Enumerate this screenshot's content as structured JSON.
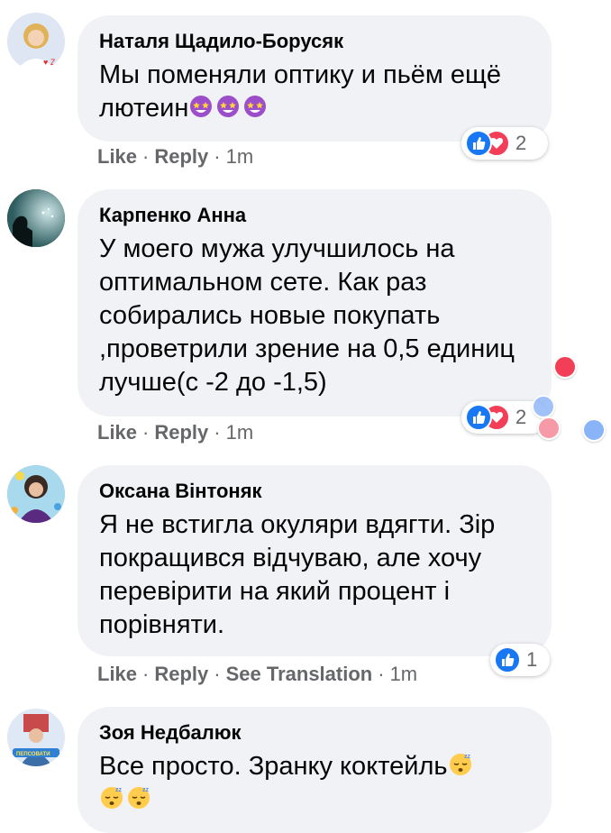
{
  "comments": [
    {
      "author": "Наталя Щадило-Борусяк",
      "text": "Мы поменяли оптику и пьём ещё лютеин",
      "emojis": [
        "star-struck-icon",
        "star-struck-icon",
        "star-struck-icon"
      ],
      "actions": {
        "like": "Like",
        "reply": "Reply",
        "time": "1m"
      },
      "reactions": {
        "types": [
          "like",
          "love"
        ],
        "count": "2"
      }
    },
    {
      "author": "Карпенко Анна",
      "text": "У моего мужа улучшилось на оптимальном сете. Как раз собирались новые покупать ,проветрили зрение на 0,5 единиц лучше(с -2 до -1,5)",
      "actions": {
        "like": "Like",
        "reply": "Reply",
        "time": "1m"
      },
      "reactions": {
        "types": [
          "like",
          "love"
        ],
        "count": "2"
      }
    },
    {
      "author": "Оксана Вінтоняк",
      "text": "Я не встигла окуляри вдягти. Зір покращився відчуваю, але хочу перевірити на який процент і порівняти.",
      "actions": {
        "like": "Like",
        "reply": "Reply",
        "translate": "See Translation",
        "time": "1m"
      },
      "reactions": {
        "types": [
          "like"
        ],
        "count": "1"
      }
    },
    {
      "author": "Зоя Недбалюк",
      "text": "Все просто. Зранку коктейль",
      "emojis": [
        "sleeping-face-icon",
        "sleeping-face-icon",
        "sleeping-face-icon"
      ]
    }
  ],
  "colors": {
    "bubble": "#f0f2f5",
    "meta": "#65676b",
    "like": "#1877f2",
    "love": "#f33e58"
  }
}
